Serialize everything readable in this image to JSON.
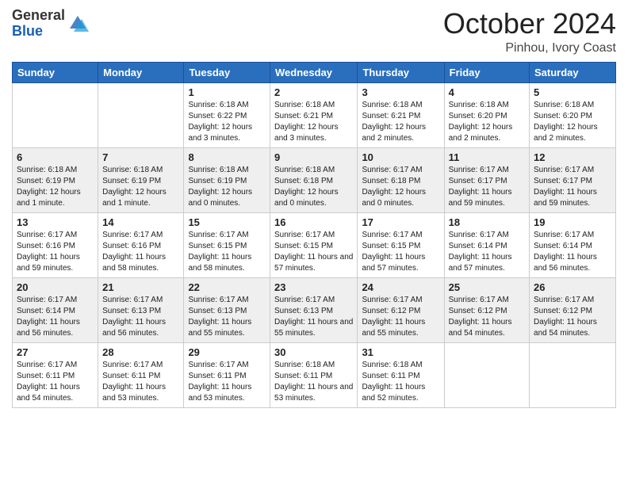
{
  "logo": {
    "general": "General",
    "blue": "Blue"
  },
  "header": {
    "month": "October 2024",
    "location": "Pinhou, Ivory Coast"
  },
  "weekdays": [
    "Sunday",
    "Monday",
    "Tuesday",
    "Wednesday",
    "Thursday",
    "Friday",
    "Saturday"
  ],
  "weeks": [
    [
      {
        "day": "",
        "info": ""
      },
      {
        "day": "",
        "info": ""
      },
      {
        "day": "1",
        "info": "Sunrise: 6:18 AM\nSunset: 6:22 PM\nDaylight: 12 hours and 3 minutes."
      },
      {
        "day": "2",
        "info": "Sunrise: 6:18 AM\nSunset: 6:21 PM\nDaylight: 12 hours and 3 minutes."
      },
      {
        "day": "3",
        "info": "Sunrise: 6:18 AM\nSunset: 6:21 PM\nDaylight: 12 hours and 2 minutes."
      },
      {
        "day": "4",
        "info": "Sunrise: 6:18 AM\nSunset: 6:20 PM\nDaylight: 12 hours and 2 minutes."
      },
      {
        "day": "5",
        "info": "Sunrise: 6:18 AM\nSunset: 6:20 PM\nDaylight: 12 hours and 2 minutes."
      }
    ],
    [
      {
        "day": "6",
        "info": "Sunrise: 6:18 AM\nSunset: 6:19 PM\nDaylight: 12 hours and 1 minute."
      },
      {
        "day": "7",
        "info": "Sunrise: 6:18 AM\nSunset: 6:19 PM\nDaylight: 12 hours and 1 minute."
      },
      {
        "day": "8",
        "info": "Sunrise: 6:18 AM\nSunset: 6:19 PM\nDaylight: 12 hours and 0 minutes."
      },
      {
        "day": "9",
        "info": "Sunrise: 6:18 AM\nSunset: 6:18 PM\nDaylight: 12 hours and 0 minutes."
      },
      {
        "day": "10",
        "info": "Sunrise: 6:17 AM\nSunset: 6:18 PM\nDaylight: 12 hours and 0 minutes."
      },
      {
        "day": "11",
        "info": "Sunrise: 6:17 AM\nSunset: 6:17 PM\nDaylight: 11 hours and 59 minutes."
      },
      {
        "day": "12",
        "info": "Sunrise: 6:17 AM\nSunset: 6:17 PM\nDaylight: 11 hours and 59 minutes."
      }
    ],
    [
      {
        "day": "13",
        "info": "Sunrise: 6:17 AM\nSunset: 6:16 PM\nDaylight: 11 hours and 59 minutes."
      },
      {
        "day": "14",
        "info": "Sunrise: 6:17 AM\nSunset: 6:16 PM\nDaylight: 11 hours and 58 minutes."
      },
      {
        "day": "15",
        "info": "Sunrise: 6:17 AM\nSunset: 6:15 PM\nDaylight: 11 hours and 58 minutes."
      },
      {
        "day": "16",
        "info": "Sunrise: 6:17 AM\nSunset: 6:15 PM\nDaylight: 11 hours and 57 minutes."
      },
      {
        "day": "17",
        "info": "Sunrise: 6:17 AM\nSunset: 6:15 PM\nDaylight: 11 hours and 57 minutes."
      },
      {
        "day": "18",
        "info": "Sunrise: 6:17 AM\nSunset: 6:14 PM\nDaylight: 11 hours and 57 minutes."
      },
      {
        "day": "19",
        "info": "Sunrise: 6:17 AM\nSunset: 6:14 PM\nDaylight: 11 hours and 56 minutes."
      }
    ],
    [
      {
        "day": "20",
        "info": "Sunrise: 6:17 AM\nSunset: 6:14 PM\nDaylight: 11 hours and 56 minutes."
      },
      {
        "day": "21",
        "info": "Sunrise: 6:17 AM\nSunset: 6:13 PM\nDaylight: 11 hours and 56 minutes."
      },
      {
        "day": "22",
        "info": "Sunrise: 6:17 AM\nSunset: 6:13 PM\nDaylight: 11 hours and 55 minutes."
      },
      {
        "day": "23",
        "info": "Sunrise: 6:17 AM\nSunset: 6:13 PM\nDaylight: 11 hours and 55 minutes."
      },
      {
        "day": "24",
        "info": "Sunrise: 6:17 AM\nSunset: 6:12 PM\nDaylight: 11 hours and 55 minutes."
      },
      {
        "day": "25",
        "info": "Sunrise: 6:17 AM\nSunset: 6:12 PM\nDaylight: 11 hours and 54 minutes."
      },
      {
        "day": "26",
        "info": "Sunrise: 6:17 AM\nSunset: 6:12 PM\nDaylight: 11 hours and 54 minutes."
      }
    ],
    [
      {
        "day": "27",
        "info": "Sunrise: 6:17 AM\nSunset: 6:11 PM\nDaylight: 11 hours and 54 minutes."
      },
      {
        "day": "28",
        "info": "Sunrise: 6:17 AM\nSunset: 6:11 PM\nDaylight: 11 hours and 53 minutes."
      },
      {
        "day": "29",
        "info": "Sunrise: 6:17 AM\nSunset: 6:11 PM\nDaylight: 11 hours and 53 minutes."
      },
      {
        "day": "30",
        "info": "Sunrise: 6:18 AM\nSunset: 6:11 PM\nDaylight: 11 hours and 53 minutes."
      },
      {
        "day": "31",
        "info": "Sunrise: 6:18 AM\nSunset: 6:11 PM\nDaylight: 11 hours and 52 minutes."
      },
      {
        "day": "",
        "info": ""
      },
      {
        "day": "",
        "info": ""
      }
    ]
  ]
}
